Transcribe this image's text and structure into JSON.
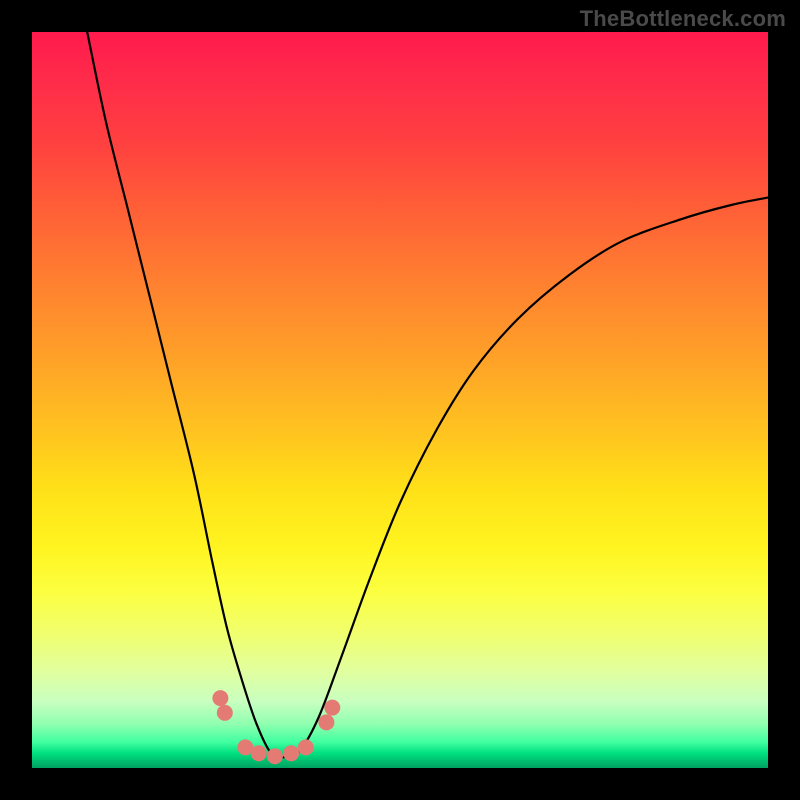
{
  "watermark": "TheBottleneck.com",
  "colors": {
    "frame": "#000000",
    "dot": "#e37b74",
    "curve": "#000000",
    "gradient_top": "#ff1a4d",
    "gradient_bottom": "#00a060"
  },
  "chart_data": {
    "type": "line",
    "title": "",
    "xlabel": "",
    "ylabel": "",
    "xlim": [
      0,
      1
    ],
    "ylim": [
      0,
      1
    ],
    "note": "Axes unlabeled; values are normalized to plot area (0–1). Curve resembles a bottleneck V with minimum near x≈0.33.",
    "series": [
      {
        "name": "curve",
        "x": [
          0.075,
          0.1,
          0.13,
          0.16,
          0.19,
          0.22,
          0.245,
          0.265,
          0.285,
          0.305,
          0.325,
          0.345,
          0.365,
          0.39,
          0.42,
          0.46,
          0.5,
          0.55,
          0.6,
          0.66,
          0.73,
          0.8,
          0.88,
          0.95,
          1.0
        ],
        "y": [
          1.0,
          0.88,
          0.76,
          0.64,
          0.52,
          0.4,
          0.28,
          0.19,
          0.12,
          0.06,
          0.02,
          0.015,
          0.025,
          0.07,
          0.15,
          0.26,
          0.36,
          0.46,
          0.54,
          0.61,
          0.67,
          0.715,
          0.745,
          0.765,
          0.775
        ]
      }
    ],
    "markers": [
      {
        "x": 0.256,
        "y": 0.095
      },
      {
        "x": 0.262,
        "y": 0.075
      },
      {
        "x": 0.29,
        "y": 0.028
      },
      {
        "x": 0.308,
        "y": 0.02
      },
      {
        "x": 0.33,
        "y": 0.016
      },
      {
        "x": 0.352,
        "y": 0.02
      },
      {
        "x": 0.372,
        "y": 0.028
      },
      {
        "x": 0.4,
        "y": 0.062
      },
      {
        "x": 0.408,
        "y": 0.082
      }
    ]
  }
}
